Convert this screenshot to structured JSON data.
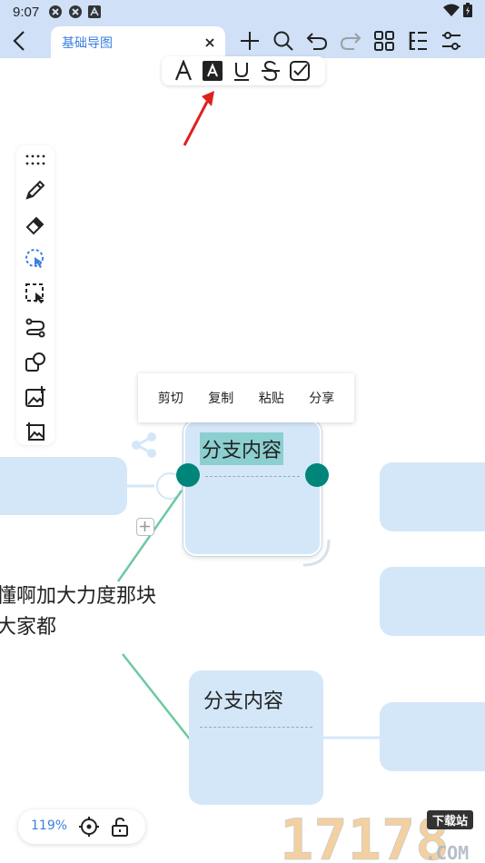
{
  "status_bar": {
    "time": "9:07"
  },
  "toolbar": {
    "tab_title": "基础导图"
  },
  "context_menu": {
    "items": [
      "剪切",
      "复制",
      "粘贴",
      "分享"
    ]
  },
  "nodes": {
    "main_label": "分支内容",
    "sub_label": "分支内容",
    "floating_text_line1": "懂啊加大力度那块",
    "floating_text_line2": "大家都"
  },
  "zoom": {
    "level": "119%"
  },
  "watermark": {
    "digits": "17178",
    "tag": "下载站",
    "domain": ".COM"
  },
  "colors": {
    "toolbar_bg": "#cfe0f7",
    "accent_blue": "#3b7fe0",
    "node_fill": "#d4e7f8",
    "handle_teal": "#00857a",
    "selection_highlight": "#8ccfd0",
    "connector_green": "#6cc9a0",
    "arrow_red": "#e02020"
  }
}
